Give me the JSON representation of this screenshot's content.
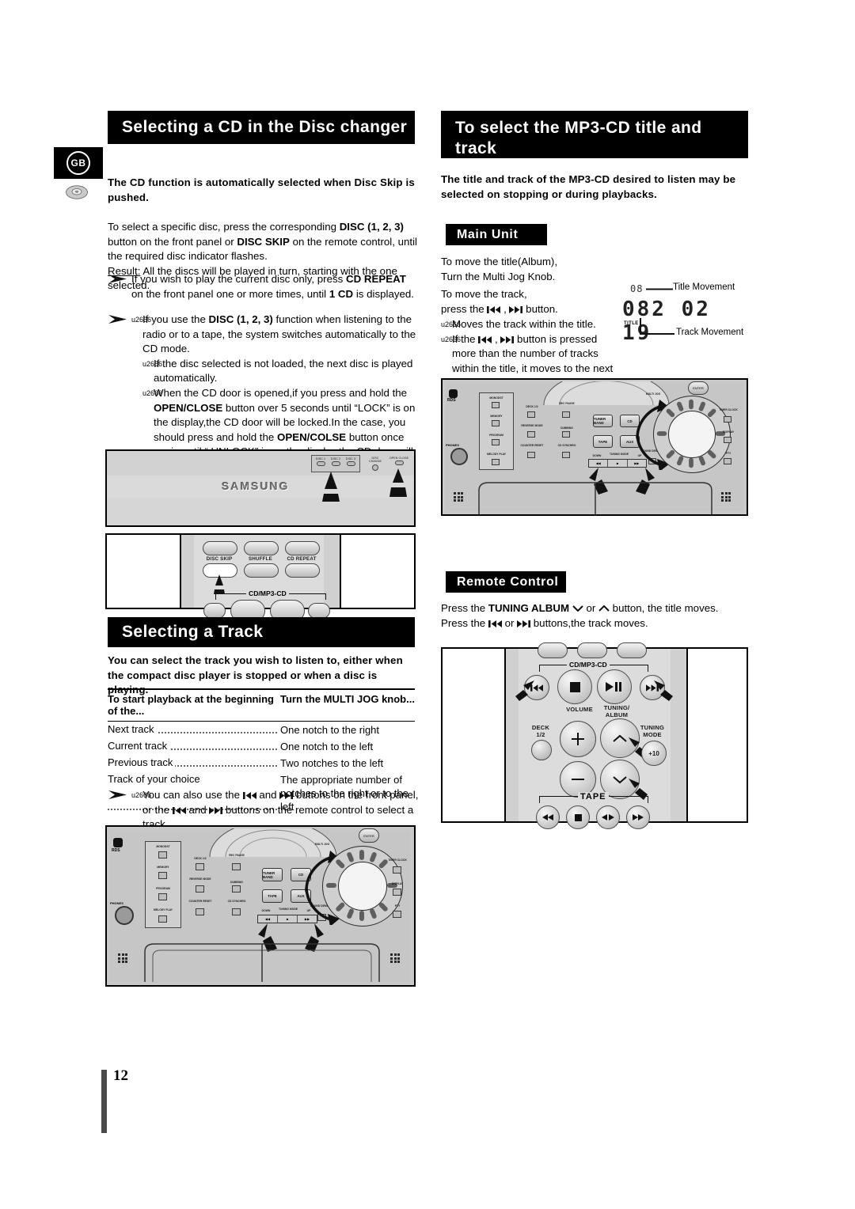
{
  "page": {
    "number": "12",
    "language_tab": "GB"
  },
  "left_column": {
    "heading": "Selecting a CD in the Disc changer",
    "intro_bold": "The CD function is automatically selected when Disc Skip is pushed.",
    "para1_a": "To select a specific disc, press the corresponding ",
    "para1_b": "DISC (1, 2, 3)",
    "para1_c": " button on the front panel or ",
    "para1_d": "DISC SKIP",
    "para1_e": " on the remote control, until the required disc indicator flashes.",
    "result_label": "Result:",
    "result_text": " All the discs will be played in turn, starting with the one selected.",
    "note1_a": "If you wish to play the current disc only, press ",
    "note1_b": "CD REPEAT",
    "note1_c": " on the front panel one or more times, until ",
    "note1_d": "1 CD",
    "note1_e": " is displayed.",
    "note2_item1_a": "If you use the ",
    "note2_item1_b": "DISC (1, 2, 3)",
    "note2_item1_c": " function when listening to the radio or to a tape, the system switches automatically to the CD mode.",
    "note2_item2": "If the disc selected is not loaded, the next disc is played automatically.",
    "note2_item3_a": "When the CD door is opened,if you press and hold the ",
    "note2_item3_b": "OPEN/CLOSE",
    "note2_item3_c": " button over 5 seconds until “LOCK” is on the display,the CD door will be locked.In the case, you should press and hold the ",
    "note2_item3_d": "OPEN/COLSE",
    "note2_item3_e": " button once again until “ UNLOCK” is on the display,the CD door will be unlocked."
  },
  "front_panel": {
    "brand": "SAMSUNG",
    "buttons": [
      "DISC 1",
      "DISC 2",
      "DISC 3"
    ],
    "disc_change": "DISC CHANGE",
    "open_close": "OPEN CLOSE"
  },
  "remote_top": {
    "buttons": [
      "DISC SKIP",
      "SHUFFLE",
      "CD REPEAT"
    ],
    "bracket_label": "CD/MP3-CD"
  },
  "track_section": {
    "heading": "Selecting a Track",
    "intro_bold": "You can select the track you wish to listen to, either when the compact disc player is stopped or when a disc is playing.",
    "table": {
      "headers": [
        "To start playback at the beginning of the...",
        "Turn the MULTI JOG knob..."
      ],
      "rows": [
        [
          "Next track",
          "One notch to the right"
        ],
        [
          "Current track",
          "One notch to the left"
        ],
        [
          "Previous track",
          "Two notches to the left"
        ],
        [
          "Track of your choice",
          "The appropriate number of notches to the right or to the left"
        ]
      ]
    },
    "note_a": "You can also use the ",
    "note_b": " and ",
    "note_c": " buttons on the front panel, or the ",
    "note_d": " and ",
    "note_e": " buttons on the remote control to select a track."
  },
  "right_column": {
    "heading_line1": "To select the MP3-CD title and",
    "heading_line2": "track",
    "intro_bold": "The title and track of the MP3-CD desired to listen may be selected on stopping or during playbacks.",
    "main_unit_label": "Main Unit",
    "mu_line1": "To move the title(Album),",
    "mu_line2": "Turn the Multi Jog Knob.",
    "mu_line3": "To move the track,",
    "mu_line4_a": "press the ",
    "mu_line4_b": " , ",
    "mu_line4_c": " button.",
    "mu_bullet1": "Moves the track within the title.",
    "mu_bullet2_a": "If the ",
    "mu_bullet2_b": " , ",
    "mu_bullet2_c": " button is pressed more than the number of tracks within the title, it moves to the next title.",
    "remote_label": "Remote Control",
    "rc_line1_a": "Press the ",
    "rc_line1_b": "TUNING ALBUM",
    "rc_line1_c": " or ",
    "rc_line1_d": " button, the title moves.",
    "rc_line2_a": "Press the ",
    "rc_line2_b": " or ",
    "rc_line2_c": " buttons,the track moves."
  },
  "lcd": {
    "top_value": "08",
    "title_movement_label": "Title Movement",
    "track_movement_label": "Track Movement",
    "title_indicator": "TITLE",
    "segments": "082  02 19"
  },
  "main_unit_panel": {
    "left_labels": [
      "MONODST",
      "MEMORY",
      "PROGRAM",
      "MELODY PLAY"
    ],
    "mid_labels": [
      "DECK 1/2",
      "REC PAUSE",
      "REVERSE MODE",
      "DUBBING",
      "COUNTER RESET",
      "CD SYNCHRO"
    ],
    "big_buttons": [
      "TUNER BAND",
      "CD",
      "TAPE",
      "AUX"
    ],
    "strip_labels": [
      "DOWN",
      "TUNING MODE",
      "UP"
    ],
    "right_labels": [
      "TIMER CLOCK",
      "DISPLAY",
      "PTY"
    ],
    "jog_label": "MULTI JOG",
    "sound_label": "SOUND DEMAND",
    "enter_label": "ENTER",
    "phones_label": "PHONES",
    "rds_label": "RDS"
  },
  "remote_bottom": {
    "bracket_cd": "CD/MP3-CD",
    "bracket_tape": "TAPE",
    "volume_label": "VOLUME",
    "tuning_album_label": "TUNING/ ALBUM",
    "tuning_mode_label": "TUNING MODE",
    "deck_label": "DECK 1/2",
    "plus_ten": "+10"
  },
  "colors": {
    "bar_bg": "#000000",
    "bar_text": "#ffffff",
    "panel_grey": "#d0d0d0",
    "page": "#ffffff"
  }
}
